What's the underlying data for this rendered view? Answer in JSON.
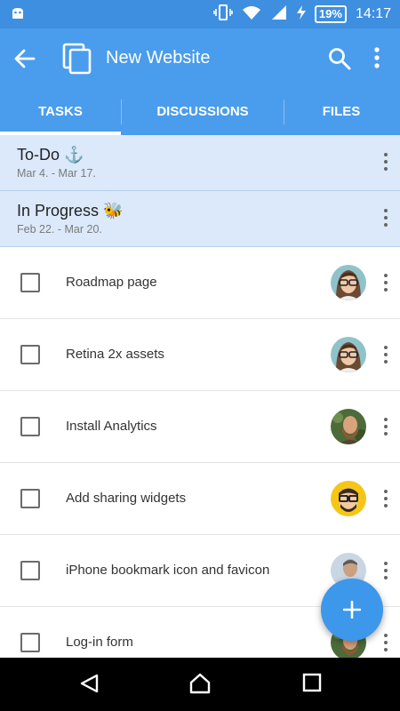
{
  "status_bar": {
    "battery": "19%",
    "time": "14:17"
  },
  "app_bar": {
    "title": "New Website"
  },
  "tabs": [
    {
      "label": "TASKS"
    },
    {
      "label": "DISCUSSIONS"
    },
    {
      "label": "FILES"
    }
  ],
  "task_lists": [
    {
      "title": "To-Do ⚓",
      "dates": "Mar 4. - Mar 17."
    },
    {
      "title": "In Progress 🐝",
      "dates": "Feb 22. - Mar 20."
    }
  ],
  "tasks": [
    {
      "label": "Roadmap page",
      "avatar": "woman-glasses"
    },
    {
      "label": "Retina 2x assets",
      "avatar": "woman-glasses"
    },
    {
      "label": "Install Analytics",
      "avatar": "bearded-man"
    },
    {
      "label": "Add sharing widgets",
      "avatar": "cartoon-man"
    },
    {
      "label": "iPhone bookmark icon and favicon",
      "avatar": "man-photo"
    },
    {
      "label": "Log-in form",
      "avatar": "bearded-man"
    }
  ],
  "colors": {
    "primary": "#4a9cec",
    "status_bar": "#3e8fe0",
    "group_bg": "#dbe9fb",
    "fab": "#3d97ea"
  }
}
